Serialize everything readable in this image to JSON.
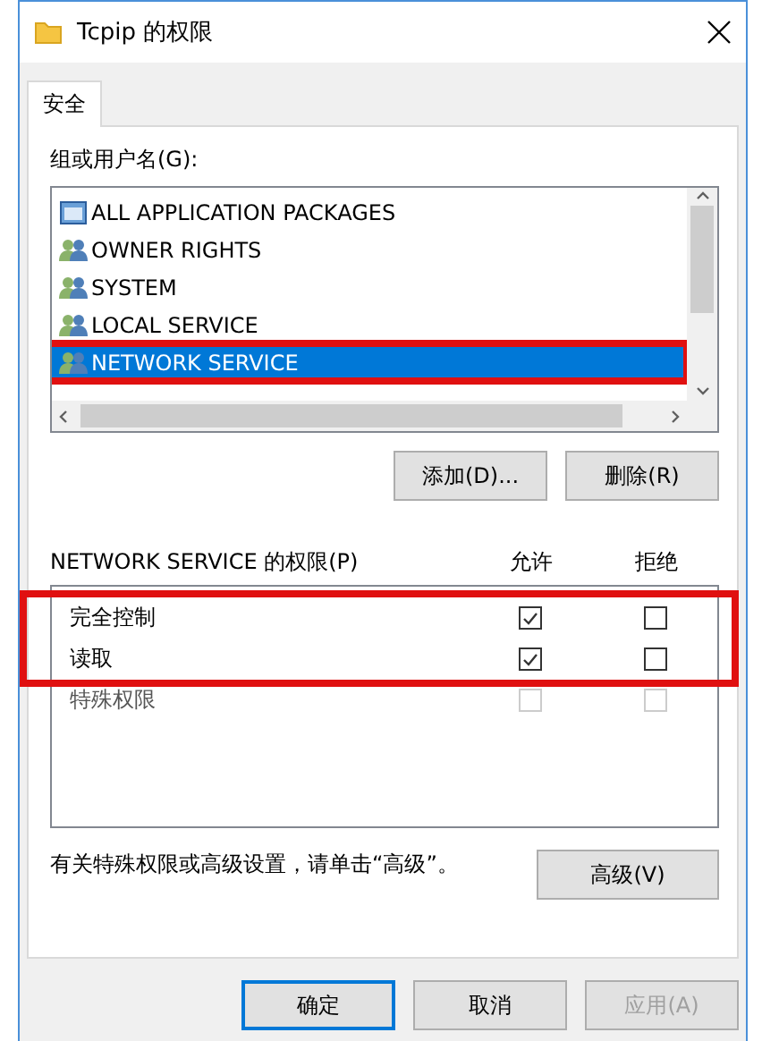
{
  "window": {
    "title": "Tcpip 的权限"
  },
  "tabs": [
    {
      "label": "安全",
      "selected": true
    }
  ],
  "users": {
    "label": "组或用户名(G):",
    "items": [
      {
        "name": "ALL APPLICATION PACKAGES",
        "kind": "package",
        "selected": false,
        "marked": false
      },
      {
        "name": "OWNER RIGHTS",
        "kind": "group",
        "selected": false,
        "marked": false
      },
      {
        "name": "SYSTEM",
        "kind": "group",
        "selected": false,
        "marked": false
      },
      {
        "name": "LOCAL SERVICE",
        "kind": "group",
        "selected": false,
        "marked": false
      },
      {
        "name": "NETWORK SERVICE",
        "kind": "group",
        "selected": true,
        "marked": true
      }
    ]
  },
  "user_buttons": [
    "添加(D)...",
    "删除(R)"
  ],
  "permissions": {
    "label": "NETWORK SERVICE 的权限(P)",
    "allow_header": "允许",
    "deny_header": "拒绝",
    "rows": [
      {
        "name": "完全控制",
        "allow": true,
        "deny": false,
        "disabled": false,
        "marked": true
      },
      {
        "name": "读取",
        "allow": true,
        "deny": false,
        "disabled": false,
        "marked": true
      },
      {
        "name": "特殊权限",
        "allow": false,
        "deny": false,
        "disabled": true,
        "marked": false
      }
    ]
  },
  "advanced_note": "有关特殊权限或高级设置，请单击“高级”。",
  "advanced_button": "高级(V)",
  "footer_buttons": [
    {
      "label": "确定",
      "default": true,
      "disabled": false
    },
    {
      "label": "取消",
      "default": false,
      "disabled": false
    },
    {
      "label": "应用(A)",
      "default": false,
      "disabled": true
    }
  ]
}
